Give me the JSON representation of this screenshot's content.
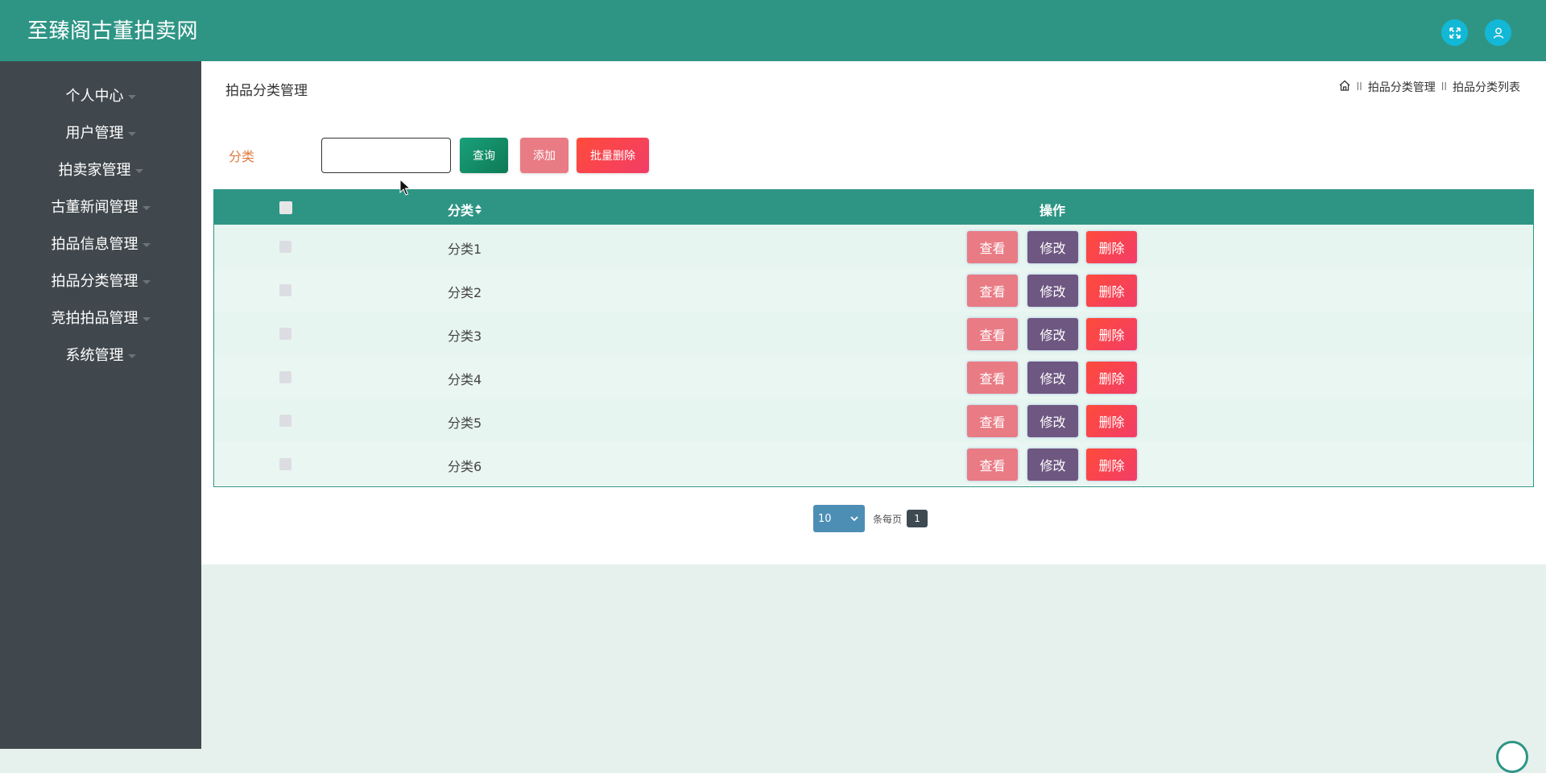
{
  "header": {
    "title": "至臻阁古董拍卖网",
    "fullscreen_icon": "fullscreen-icon",
    "user_icon": "user-icon"
  },
  "sidebar": {
    "items": [
      {
        "label": "个人中心"
      },
      {
        "label": "用户管理"
      },
      {
        "label": "拍卖家管理"
      },
      {
        "label": "古董新闻管理"
      },
      {
        "label": "拍品信息管理"
      },
      {
        "label": "拍品分类管理"
      },
      {
        "label": "竞拍拍品管理"
      },
      {
        "label": "系统管理"
      }
    ]
  },
  "page": {
    "title": "拍品分类管理",
    "breadcrumb": {
      "home_icon": "home-icon",
      "item1": "拍品分类管理",
      "item2": "拍品分类列表",
      "separator": "ll"
    }
  },
  "search": {
    "label": "分类",
    "value": "",
    "placeholder": "",
    "query_label": "查询",
    "add_label": "添加",
    "batch_delete_label": "批量删除"
  },
  "table": {
    "columns": {
      "category": "分类",
      "operation": "操作"
    },
    "rows": [
      {
        "name": "分类1"
      },
      {
        "name": "分类2"
      },
      {
        "name": "分类3"
      },
      {
        "name": "分类4"
      },
      {
        "name": "分类5"
      },
      {
        "name": "分类6"
      }
    ],
    "actions": {
      "view": "查看",
      "edit": "修改",
      "delete": "删除"
    }
  },
  "pagination": {
    "page_size": "10",
    "per_page_text": "条每页",
    "current_page": "1"
  },
  "colors": {
    "header": "#2e9585",
    "sidebar": "#40484d",
    "view": "#e97b84",
    "edit": "#6e5781",
    "delete": "#f23d68"
  }
}
